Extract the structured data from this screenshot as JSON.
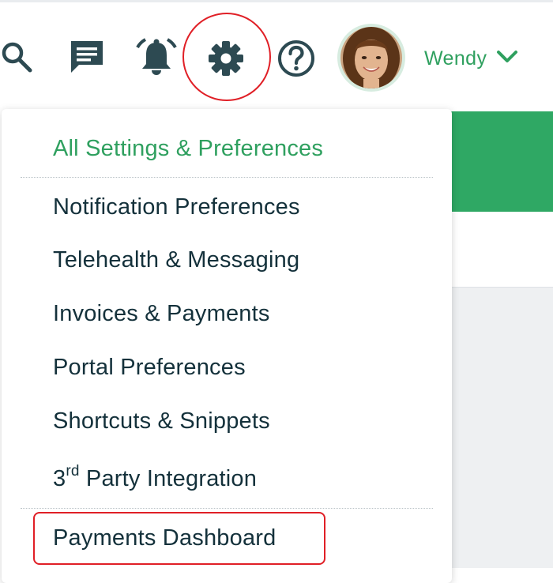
{
  "header": {
    "icons": {
      "search": "search-icon",
      "messages": "chat-icon",
      "notifications": "bell-icon",
      "settings": "gear-icon",
      "help": "help-icon"
    },
    "user": {
      "name": "Wendy",
      "avatar": "avatar",
      "menu_icon": "chevron-down-icon"
    }
  },
  "settings_menu": {
    "header_label": "All Settings & Preferences",
    "items": [
      "Notification Preferences",
      "Telehealth & Messaging",
      "Invoices & Payments",
      "Portal Preferences",
      "Shortcuts & Snippets"
    ],
    "third_party": {
      "prefix": "3",
      "superscript": "rd",
      "suffix": " Party Integration"
    },
    "payments_dashboard": "Payments Dashboard"
  },
  "colors": {
    "brand_green": "#2fa05f",
    "banner_green": "#2fa864",
    "text_dark": "#14313b",
    "icon_dark": "#2d4a52",
    "annotation_red": "#e01f26"
  }
}
